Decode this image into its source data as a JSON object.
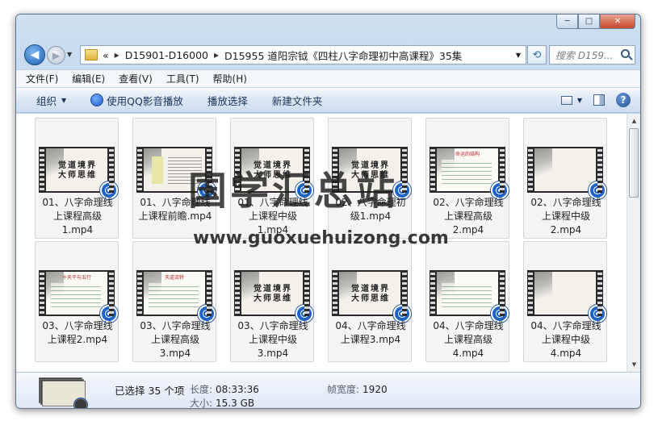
{
  "window": {
    "caption": {
      "minimize": "─",
      "maximize": "□",
      "close": "✕"
    }
  },
  "nav": {
    "breadcrumb": [
      "«",
      "D15901-D16000",
      "D15955 道阳宗钺《四柱八字命理初中高课程》35集"
    ],
    "search_placeholder": "搜索 D159..."
  },
  "menu": [
    "文件(F)",
    "编辑(E)",
    "查看(V)",
    "工具(T)",
    "帮助(H)"
  ],
  "toolbar": {
    "organize": "组织",
    "play_with": "使用QQ影音播放",
    "play_selection": "播放选择",
    "new_folder": "新建文件夹",
    "help": "?"
  },
  "files": [
    {
      "line1": "01、八字命理线",
      "line2": "上课程高级",
      "line3": "1.mp4",
      "thumb": "觉道境界 大师思维",
      "style": "title"
    },
    {
      "line1": "01、八字命理线",
      "line2": "上课程前瞻.mp4",
      "line3": "",
      "thumb": "",
      "style": "doc"
    },
    {
      "line1": "01、八字命理线",
      "line2": "上课程中级",
      "line3": "1.mp4",
      "thumb": "觉道境界 大师思维",
      "style": "title"
    },
    {
      "line1": "02、八字命理初",
      "line2": "级1.mp4",
      "line3": "",
      "thumb": "觉道境界 大师思维",
      "style": "title"
    },
    {
      "line1": "02、八字命理线",
      "line2": "上课程高级",
      "line3": "2.mp4",
      "thumb": "命运的结构",
      "style": "slide"
    },
    {
      "line1": "02、八字命理线",
      "line2": "上课程中级",
      "line3": "2.mp4",
      "thumb": "",
      "style": "ink"
    },
    {
      "line1": "03、八字命理线",
      "line2": "上课程2.mp4",
      "line3": "",
      "thumb": "十天干与五行",
      "style": "slide"
    },
    {
      "line1": "03、八字命理线",
      "line2": "上课程高级",
      "line3": "3.mp4",
      "thumb": "天道流转",
      "style": "slide"
    },
    {
      "line1": "03、八字命理线",
      "line2": "上课程中级",
      "line3": "3.mp4",
      "thumb": "觉道境界 大师思维",
      "style": "title"
    },
    {
      "line1": "04、八字命理线",
      "line2": "上课程3.mp4",
      "line3": "",
      "thumb": "觉道境界 大师思维",
      "style": "title"
    },
    {
      "line1": "04、八字命理线",
      "line2": "上课程高级",
      "line3": "4.mp4",
      "thumb": "",
      "style": "slide"
    },
    {
      "line1": "04、八字命理线",
      "line2": "上课程中级",
      "line3": "4.mp4",
      "thumb": "",
      "style": "ink"
    }
  ],
  "watermark": {
    "cn": "国学汇总站",
    "url": "www.guoxuehuizong.com"
  },
  "details": {
    "selected": "已选择 35 个项",
    "length_label": "长度:",
    "length_value": "08:33:36",
    "width_label": "帧宽度:",
    "width_value": "1920",
    "size_label": "大小:",
    "size_value": "15.3 GB"
  },
  "colors": {
    "accent": "#1f63c9",
    "frame": "#5b7593"
  }
}
